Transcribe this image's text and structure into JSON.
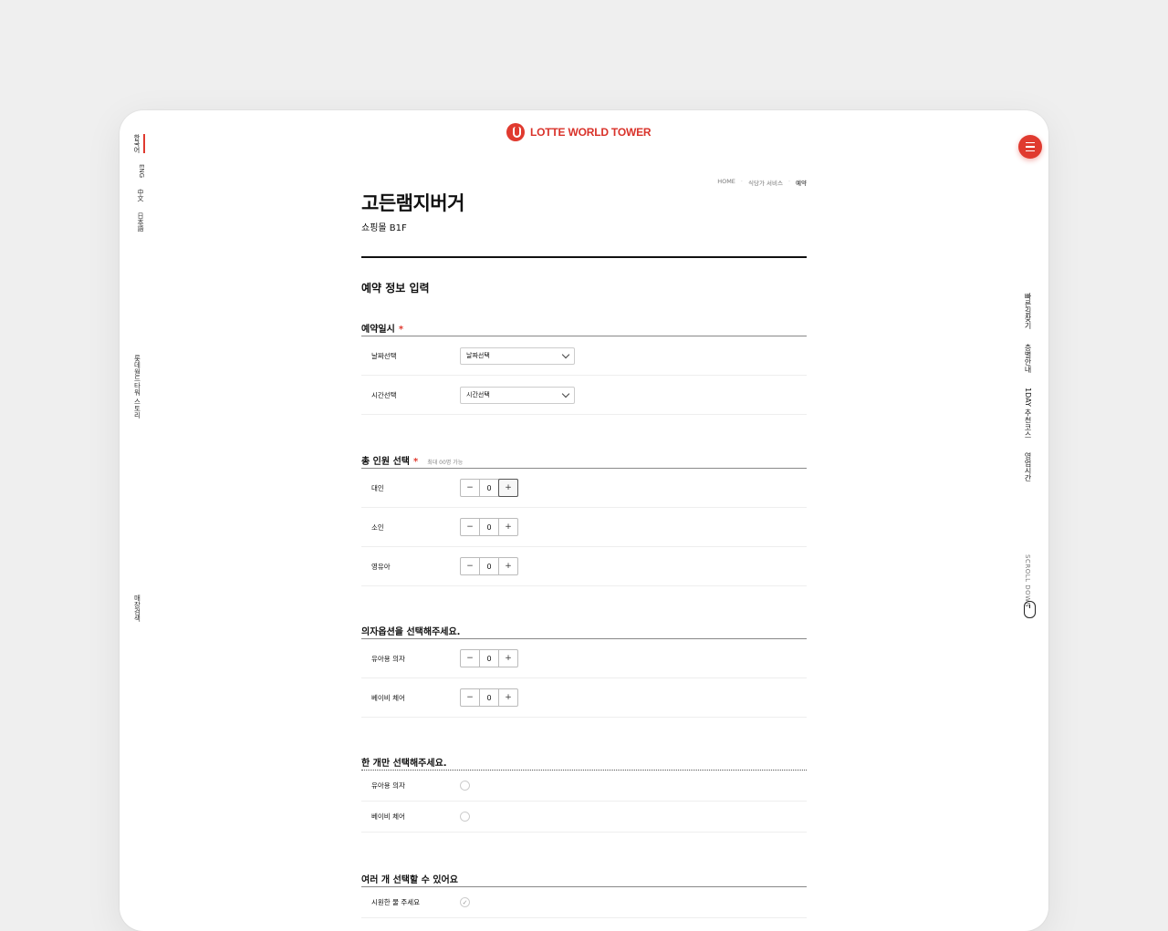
{
  "header": {
    "logo_text": "LOTTE WORLD TOWER"
  },
  "lang_nav": [
    "한국어",
    "ENG",
    "中文",
    "日本語"
  ],
  "left_links": {
    "story": "롯데월드타워 스토리",
    "store_search": "매장검색"
  },
  "right_links": [
    "빠른길찾기",
    "층별안내",
    "1DAY 추천코스",
    "영업시간"
  ],
  "scroll_down": "SCROLL DOWN",
  "breadcrumb": [
    "HOME",
    "식당가 서비스",
    "예약"
  ],
  "page": {
    "title": "고든램지버거",
    "subtitle": "쇼핑몰 B1F",
    "section_title": "예약 정보 입력"
  },
  "datetime": {
    "heading": "예약일시",
    "required": "*",
    "date_label": "날짜선택",
    "date_value": "날짜선택",
    "time_label": "시간선택",
    "time_value": "시간선택"
  },
  "people": {
    "heading": "총 인원 선택",
    "required": "*",
    "note": "최대 00명 가능",
    "rows": [
      {
        "label": "대인",
        "value": "0"
      },
      {
        "label": "소인",
        "value": "0"
      },
      {
        "label": "영유아",
        "value": "0"
      }
    ]
  },
  "chairs": {
    "heading": "의자옵션을 선택해주세요.",
    "rows": [
      {
        "label": "유아용 의자",
        "value": "0"
      },
      {
        "label": "베이비 체어",
        "value": "0"
      }
    ]
  },
  "single": {
    "heading": "한 개만 선택해주세요.",
    "rows": [
      {
        "label": "유아용 의자"
      },
      {
        "label": "베이비 체어"
      }
    ]
  },
  "multi": {
    "heading": "여러 개 선택할 수 있어요",
    "rows": [
      {
        "label": "시원한 물 주세요"
      }
    ]
  },
  "icons": {
    "minus": "−",
    "plus": "+",
    "check": "✓"
  },
  "colors": {
    "brand": "#e03a2f",
    "background": "#efefef"
  }
}
